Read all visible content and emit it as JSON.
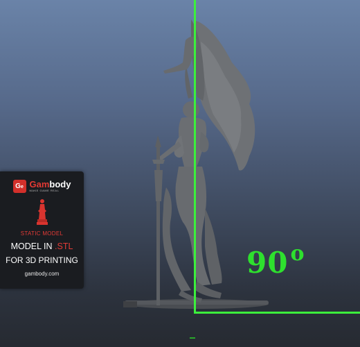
{
  "viewport": {
    "angle": "90",
    "angle_unit": "o",
    "frame_color": "#3cf03c",
    "model": "winged female warrior statue with spear on round base"
  },
  "promo": {
    "brand_logo_mark": "G",
    "brand_name_first": "Gam",
    "brand_name_rest": "body",
    "brand_tagline": "MAKE GAME REAL",
    "figure_icon": "statue-icon",
    "static_label": "STATIC MODEL",
    "model_in": "MODEL IN ",
    "format": ".STL",
    "for_printing": "FOR 3D PRINTING",
    "website": "gambody.com",
    "accent_color": "#e33b36"
  }
}
